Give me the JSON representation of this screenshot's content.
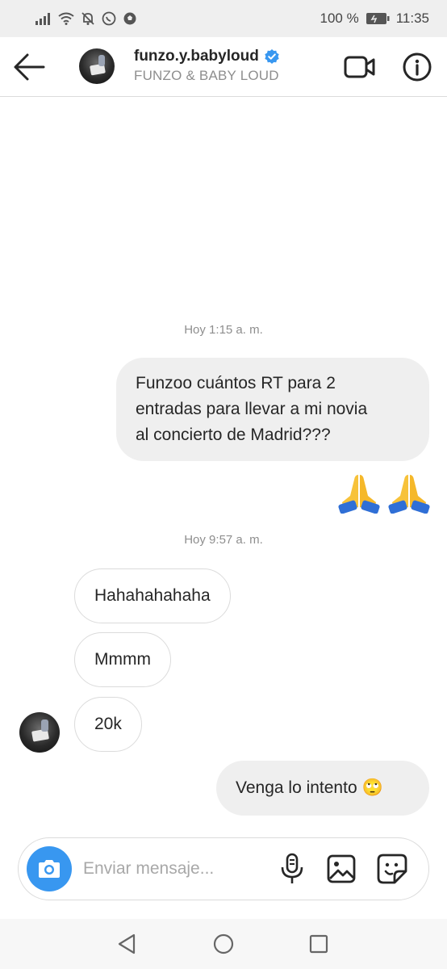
{
  "status_bar": {
    "battery": "100 %",
    "time": "11:35"
  },
  "header": {
    "username": "funzo.y.babyloud",
    "display_name": "FUNZO & BABY LOUD",
    "verified": true
  },
  "messages": [
    {
      "type": "timestamp",
      "text": "Hoy 1:15 a. m."
    },
    {
      "type": "outgoing",
      "lines": [
        "Funzoo cuántos RT para 2",
        "entradas para llevar a mi novia",
        "al concierto de Madrid???"
      ]
    },
    {
      "type": "outgoing-emoji",
      "text": "🙏🙏"
    },
    {
      "type": "timestamp",
      "text": "Hoy 9:57 a. m."
    },
    {
      "type": "incoming",
      "text": "Hahahahahaha"
    },
    {
      "type": "incoming",
      "text": "Mmmm"
    },
    {
      "type": "incoming",
      "text": "20k"
    },
    {
      "type": "outgoing",
      "text": "Venga lo intento 🙄"
    }
  ],
  "composer": {
    "placeholder": "Enviar mensaje..."
  },
  "colors": {
    "accent": "#3897f0",
    "verified": "#3897f0",
    "outgoing_bubble": "#efefef",
    "border": "#dbdbdb"
  },
  "icons": [
    "back-arrow-icon",
    "verified-badge-icon",
    "video-call-icon",
    "info-icon",
    "camera-icon",
    "microphone-icon",
    "gallery-icon",
    "sticker-icon",
    "nav-back-icon",
    "nav-home-icon",
    "nav-recents-icon"
  ]
}
